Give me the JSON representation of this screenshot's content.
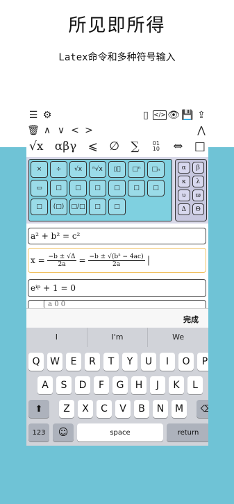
{
  "header": {
    "title": "所见即所得",
    "subtitle": "Latex命令和多种符号输入"
  },
  "toolbar": {
    "row1_left": [
      "☰",
      "⚙"
    ],
    "row1_right": [
      "▯",
      "</>",
      "👁",
      "💾",
      "⇪"
    ],
    "row2_left": [
      "🗑",
      "∧",
      "∨",
      "<",
      ">"
    ],
    "row2_right": [
      "⋀"
    ]
  },
  "symbols": {
    "items": [
      "√x",
      "αβγ",
      "⩽",
      "∅",
      "∑",
      "01 10",
      "⇔",
      "□"
    ]
  },
  "templates": {
    "rows": [
      [
        "×",
        "÷",
        "√x",
        "ⁿ√x",
        "▯⃞",
        "□ⁿ",
        "□ₙ"
      ],
      [
        "▭",
        "□",
        "□",
        "□",
        "□",
        "□",
        "□"
      ],
      [
        "□",
        "(□)",
        "□/□",
        "□",
        "□"
      ]
    ]
  },
  "greek": {
    "rows": [
      [
        "α",
        "β"
      ],
      [
        "κ",
        "λ"
      ],
      [
        "υ",
        "ϖ"
      ],
      [
        "Δ",
        "Θ"
      ]
    ]
  },
  "formulas": {
    "f1": "a² + b² = c²",
    "f2_lhs": "x =",
    "f2_num1": "−b ± √Δ",
    "f2_den1": "2a",
    "f2_eq": "=",
    "f2_num2": "−b ± √(b² − 4ac)",
    "f2_den2": "2a",
    "f3": "eⁱᵖ + 1 = 0",
    "f4": "[ a 0 0"
  },
  "keyboard": {
    "done_label": "完成",
    "suggestions": [
      "I",
      "I'm",
      "We"
    ],
    "row1": [
      "Q",
      "W",
      "E",
      "R",
      "T",
      "Y",
      "U",
      "I",
      "O",
      "P"
    ],
    "row2": [
      "A",
      "S",
      "D",
      "F",
      "G",
      "H",
      "J",
      "K",
      "L"
    ],
    "row3": [
      "Z",
      "X",
      "C",
      "V",
      "B",
      "N",
      "M"
    ],
    "shift": "⬆",
    "backspace": "⌫",
    "n123": "123",
    "emoji": "☺",
    "space": "space",
    "return": "return"
  },
  "colors": {
    "accent": "#6fc3d6",
    "template_bg": "#7fd0e0",
    "greek_bg": "#c8c8e0"
  }
}
